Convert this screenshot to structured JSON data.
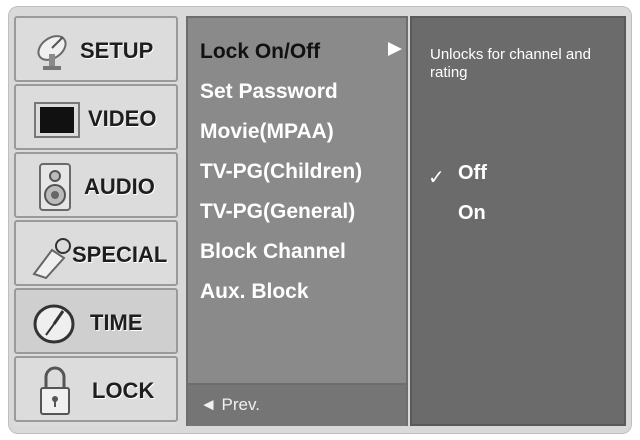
{
  "tabs": [
    {
      "label": "SETUP",
      "icon": "satellite-dish-icon"
    },
    {
      "label": "VIDEO",
      "icon": "tv-screen-icon"
    },
    {
      "label": "AUDIO",
      "icon": "speaker-icon"
    },
    {
      "label": "SPECIAL",
      "icon": "key-tag-icon"
    },
    {
      "label": "TIME",
      "icon": "clock-icon",
      "active": true
    },
    {
      "label": "LOCK",
      "icon": "padlock-icon"
    }
  ],
  "menu": {
    "items": [
      "Lock On/Off",
      "Set Password",
      "Movie(MPAA)",
      "TV-PG(Children)",
      "TV-PG(General)",
      "Block Channel",
      "Aux. Block"
    ],
    "selected_index": 0,
    "prev_label": "◄ Prev."
  },
  "panel": {
    "help_text": "Unlocks for channel and rating",
    "options": [
      "Off",
      "On"
    ],
    "checked_index": 0,
    "check_glyph": "✓"
  },
  "colors": {
    "frame": "#d9d9d9",
    "menu_bg": "#8a8a8a",
    "panel_bg": "#6b6b6b",
    "text_light": "#ffffff",
    "text_dark": "#111111"
  }
}
